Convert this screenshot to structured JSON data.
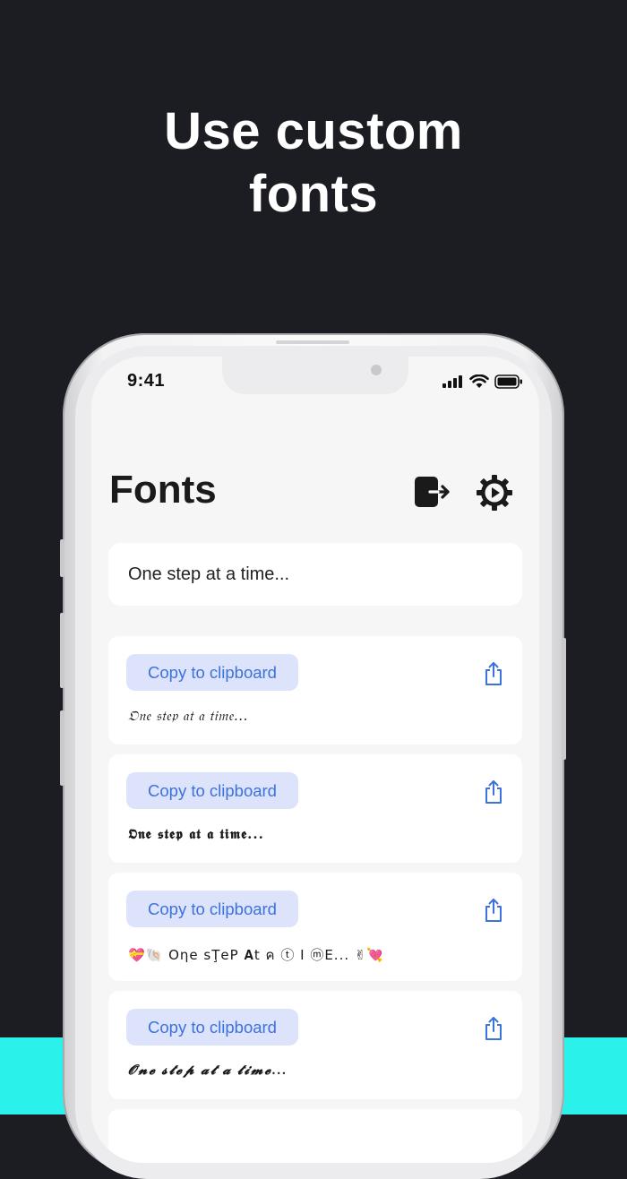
{
  "headline": {
    "line1": "Use custom",
    "line2": "fonts"
  },
  "status_bar": {
    "time": "9:41"
  },
  "header": {
    "title": "Fonts",
    "export_icon": "export-icon",
    "settings_icon": "gear-icon"
  },
  "input": {
    "value": "One step at a time..."
  },
  "colors": {
    "accent": "#3c72dc",
    "accent_bg": "#dce3fb",
    "band": "#2af2ea",
    "dark_bg": "#1c1d22"
  },
  "cards": [
    {
      "copy_label": "Copy to clipboard",
      "sample": "𝔒𝔫𝔢 𝔰𝔱𝔢𝔭 𝔞𝔱 𝔞 𝔱𝔦𝔪𝔢..."
    },
    {
      "copy_label": "Copy to clipboard",
      "sample": "𝕺𝖓𝖊 𝖘𝖙𝖊𝖕 𝖆𝖙 𝖆 𝖙𝖎𝖒𝖊..."
    },
    {
      "copy_label": "Copy to clipboard",
      "sample": "💝🐚 Oηe sŢeР 𝐀t ค ⓣ I ⓜE... ✌💘"
    },
    {
      "copy_label": "Copy to clipboard",
      "sample": "𝓞𝓷𝓮 𝓼𝓽𝓮𝓹 𝓪𝓽 𝓪 𝓽𝓲𝓶𝓮..."
    }
  ]
}
